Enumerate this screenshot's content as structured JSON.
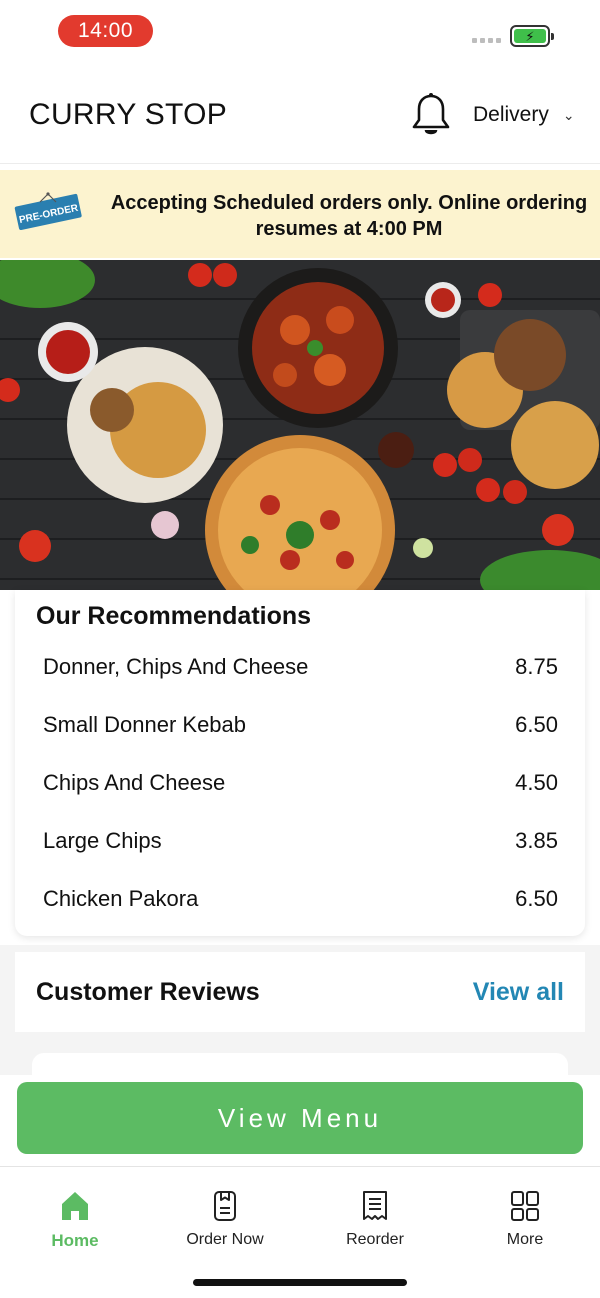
{
  "status_bar": {
    "time": "14:00"
  },
  "header": {
    "brand": "CURRY STOP",
    "order_mode": "Delivery"
  },
  "banner": {
    "tag": "PRE-ORDER",
    "message": "Accepting Scheduled orders only. Online ordering resumes at 4:00 PM"
  },
  "recommendations": {
    "title": "Our Recommendations",
    "items": [
      {
        "name": "Donner, Chips And Cheese",
        "price": "8.75"
      },
      {
        "name": "Small Donner Kebab",
        "price": "6.50"
      },
      {
        "name": "Chips And Cheese",
        "price": "4.50"
      },
      {
        "name": "Large Chips",
        "price": "3.85"
      },
      {
        "name": "Chicken Pakora",
        "price": "6.50"
      }
    ]
  },
  "reviews": {
    "title": "Customer Reviews",
    "view_all": "View all"
  },
  "view_menu_label": "View Menu",
  "nav": {
    "items": [
      {
        "label": "Home",
        "icon": "home-icon"
      },
      {
        "label": "Order Now",
        "icon": "order-now-icon"
      },
      {
        "label": "Reorder",
        "icon": "receipt-icon"
      },
      {
        "label": "More",
        "icon": "grid-icon"
      }
    ]
  },
  "colors": {
    "accent_green": "#5cbb63",
    "link_blue": "#2387b4",
    "banner_bg": "#fcf3cf",
    "time_pill": "#e23a2e"
  }
}
